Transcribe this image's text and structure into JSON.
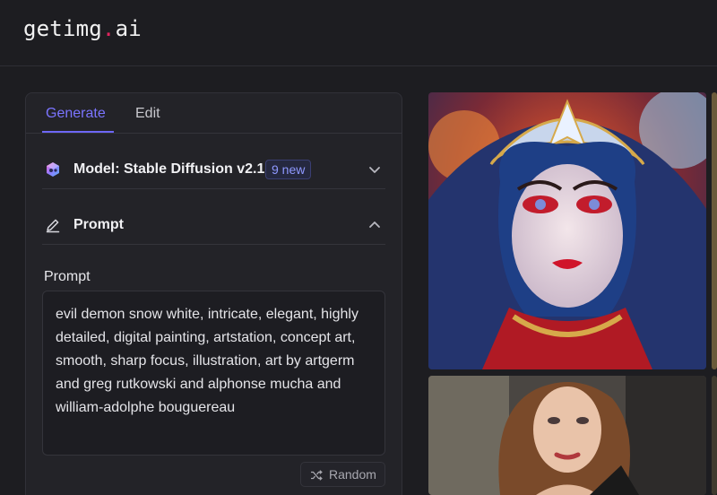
{
  "app": {
    "logo_text": "getimg",
    "logo_dot": ".",
    "logo_suffix": "ai"
  },
  "tabs": [
    {
      "label": "Generate",
      "active": true
    },
    {
      "label": "Edit",
      "active": false
    }
  ],
  "model": {
    "label": "Model: Stable Diffusion v2.1",
    "badge": "9 new",
    "icon": "model-cube-icon",
    "expanded": false
  },
  "prompt_section": {
    "title": "Prompt",
    "icon": "pencil-icon",
    "expanded": true
  },
  "prompt": {
    "label": "Prompt",
    "value": "evil demon snow white, intricate, elegant, highly detailed, digital painting, artstation, concept art, smooth, sharp focus, illustration, art by artgerm and greg rutkowski and alphonse mucha and william-adolphe bouguereau"
  },
  "random_button": {
    "label": "Random",
    "icon": "shuffle-icon"
  },
  "colors": {
    "accent": "#6d66f5",
    "brand_dot": "#e0245e",
    "background": "#1d1d21",
    "panel": "#232328"
  }
}
